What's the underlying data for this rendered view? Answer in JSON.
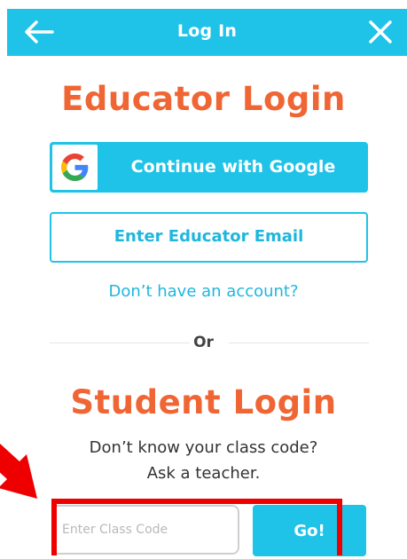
{
  "header": {
    "title": "Log In",
    "back_icon": "arrow-left-icon",
    "close_icon": "close-icon"
  },
  "educator": {
    "title": "Educator Login",
    "google_button_label": "Continue with Google",
    "google_icon": "google-g-icon",
    "email_button_label": "Enter Educator Email",
    "signup_link": "Don’t have an account?"
  },
  "divider_text": "Or",
  "student": {
    "title": "Student Login",
    "hint_line1": "Don’t know your class code?",
    "hint_line2": "Ask a teacher.",
    "class_code_placeholder": "Enter Class Code",
    "class_code_value": "",
    "go_button_label": "Go!"
  },
  "colors": {
    "accent_blue": "#1fc3e8",
    "title_orange": "#f06534",
    "annotation_red": "#ee0000"
  }
}
